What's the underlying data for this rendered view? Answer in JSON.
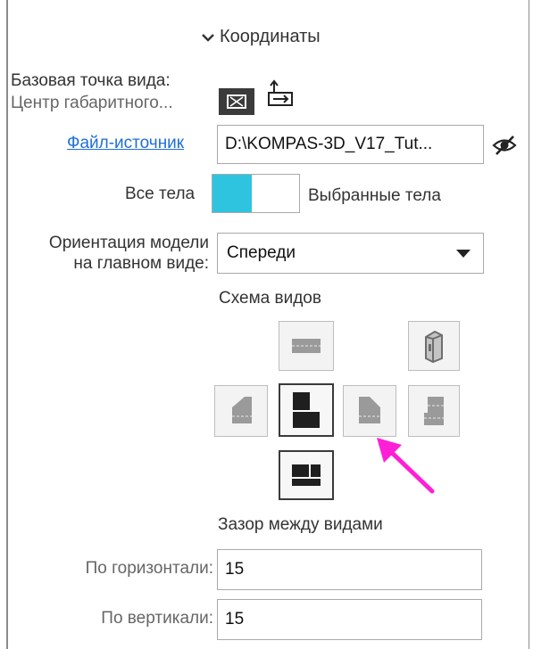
{
  "section": {
    "title": "Координаты"
  },
  "base_point": {
    "label": "Базовая точка вида:",
    "value": "Центр габаритного..."
  },
  "source_file": {
    "link": "Файл-источник",
    "value": "D:\\KOMPAS-3D_V17_Tut..."
  },
  "bodies": {
    "all": "Все тела",
    "selected": "Выбранные тела",
    "state": "all"
  },
  "orientation": {
    "label_line1": "Ориентация модели",
    "label_line2": "на главном виде:",
    "value": "Спереди"
  },
  "view_scheme": {
    "title": "Схема видов"
  },
  "gap": {
    "title": "Зазор между видами",
    "horizontal_label": "По горизонтали:",
    "horizontal_value": "15",
    "vertical_label": "По вертикали:",
    "vertical_value": "15"
  },
  "colors": {
    "accent": "#2ec4e0",
    "link": "#1f6fd6",
    "arrow": "#ff1fd6"
  }
}
